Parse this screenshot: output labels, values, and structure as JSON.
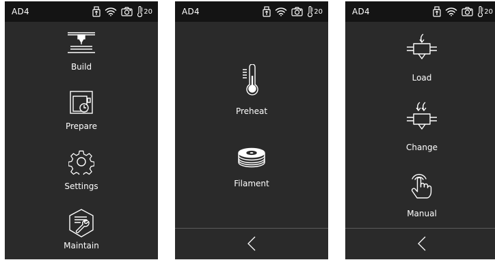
{
  "status_bar": {
    "device_name": "AD4",
    "temperature": "20",
    "icons": [
      "usb-icon",
      "wifi-icon",
      "camera-icon",
      "thermometer-icon"
    ]
  },
  "screens": [
    {
      "name": "main-menu",
      "items": [
        {
          "label": "Build",
          "icon": "build-icon"
        },
        {
          "label": "Prepare",
          "icon": "prepare-icon"
        },
        {
          "label": "Settings",
          "icon": "gear-icon"
        },
        {
          "label": "Maintain",
          "icon": "wrench-icon"
        }
      ]
    },
    {
      "name": "prepare-menu",
      "items": [
        {
          "label": "Preheat",
          "icon": "thermometer-icon"
        },
        {
          "label": "Filament",
          "icon": "spool-icon"
        }
      ],
      "back_icon": "chevron-left-icon"
    },
    {
      "name": "filament-menu",
      "items": [
        {
          "label": "Load",
          "icon": "filament-load-icon"
        },
        {
          "label": "Change",
          "icon": "filament-change-icon"
        },
        {
          "label": "Manual",
          "icon": "hand-pointer-icon"
        }
      ],
      "back_icon": "chevron-left-icon"
    }
  ],
  "colors": {
    "panel_background": "#2a2a2a",
    "status_bar_background": "#141414",
    "text": "#ffffff",
    "divider": "#5c5c5c"
  }
}
